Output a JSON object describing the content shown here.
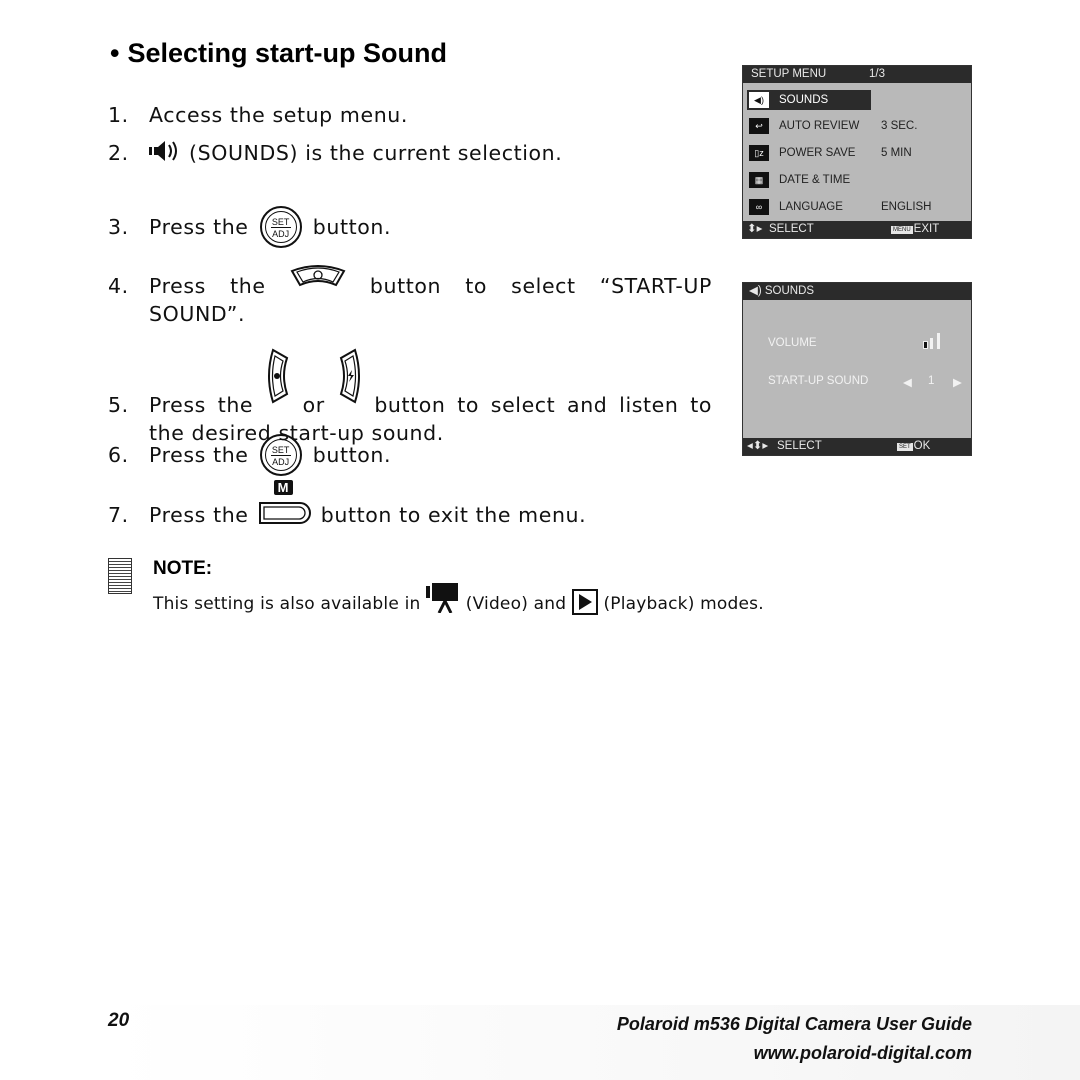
{
  "page": {
    "title": "Selecting start-up Sound",
    "bullet": "•",
    "steps": [
      {
        "num": "1.",
        "text": "Access the setup menu."
      },
      {
        "num": "2.",
        "text": "(SOUNDS) is the current selection.",
        "icon": "speaker-icon"
      },
      {
        "num": "3.",
        "before": "Press the",
        "after": "button.",
        "icon": "set-adj-button-icon"
      },
      {
        "num": "4.",
        "before": "Press the",
        "after": "button to select “START-UP",
        "cont": "SOUND”.",
        "icon": "down-selftimer-button-icon"
      },
      {
        "num": "5.",
        "before": "Press the",
        "mid": "or",
        "after": "button to select and listen to",
        "cont": "the desired start-up sound.",
        "icons": [
          "left-macro-button-icon",
          "right-flash-button-icon"
        ]
      },
      {
        "num": "6.",
        "before": "Press the",
        "after": "button.",
        "icon": "set-adj-button-icon"
      },
      {
        "num": "7.",
        "before": "Press the",
        "after": "button to exit the menu.",
        "icon": "menu-m-button-icon"
      }
    ],
    "set_label_top": "SET",
    "set_label_bottom": "ADJ",
    "m_label": "M",
    "note": {
      "label": "NOTE:",
      "text_before": "This setting is also available in",
      "video_label": "(Video) and",
      "playback_label": "(Playback) modes."
    }
  },
  "lcd_setup": {
    "header": "SETUP MENU",
    "page": "1/3",
    "items": [
      {
        "icon": "sounds-icon",
        "label": "SOUNDS",
        "value": "",
        "selected": true
      },
      {
        "icon": "auto-review-icon",
        "label": "AUTO REVIEW",
        "value": "3 SEC."
      },
      {
        "icon": "power-save-icon",
        "label": "POWER SAVE",
        "value": "5 MIN"
      },
      {
        "icon": "date-time-icon",
        "label": "DATE & TIME",
        "value": ""
      },
      {
        "icon": "language-icon",
        "label": "LANGUAGE",
        "value": "ENGLISH"
      }
    ],
    "footer_left": "SELECT",
    "footer_key": "MENU",
    "footer_right": "EXIT"
  },
  "lcd_sounds": {
    "header": "SOUNDS",
    "volume_label": "VOLUME",
    "volume_level": "1 of 3",
    "startup_label": "START-UP SOUND",
    "startup_value": "1",
    "footer_left": "SELECT",
    "footer_key": "SET",
    "footer_right": "OK"
  },
  "footer": {
    "page_number": "20",
    "guide_title": "Polaroid m536 Digital Camera User Guide",
    "website": "www.polaroid-digital.com"
  }
}
